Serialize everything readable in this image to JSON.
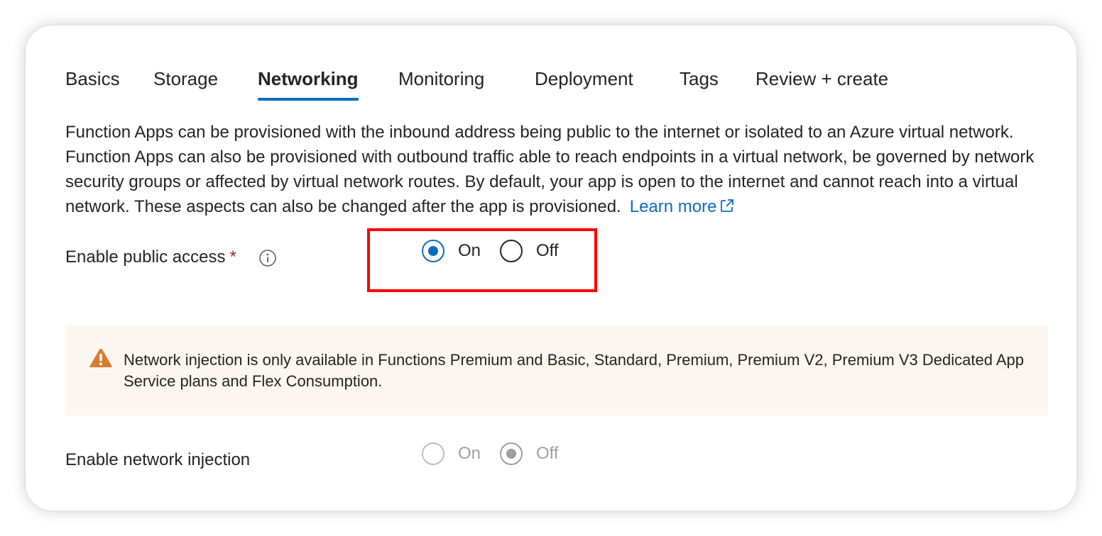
{
  "tabs": [
    {
      "label": "Basics",
      "active": false
    },
    {
      "label": "Storage",
      "active": false
    },
    {
      "label": "Networking",
      "active": true
    },
    {
      "label": "Monitoring",
      "active": false
    },
    {
      "label": "Deployment",
      "active": false
    },
    {
      "label": "Tags",
      "active": false
    },
    {
      "label": "Review + create",
      "active": false
    }
  ],
  "description": {
    "text": "Function Apps can be provisioned with the inbound address being public to the internet or isolated to an Azure virtual network. Function Apps can also be provisioned with outbound traffic able to reach endpoints in a virtual network, be governed by network security groups or affected by virtual network routes. By default, your app is open to the internet and cannot reach into a virtual network. These aspects can also be changed after the app is provisioned.",
    "link_label": "Learn more",
    "link_icon": "external-link-icon"
  },
  "public_access": {
    "label": "Enable public access",
    "required_mark": "*",
    "info_icon": "info-icon",
    "options": [
      "On",
      "Off"
    ],
    "selected": "On"
  },
  "warning": {
    "icon": "warning-icon",
    "text": "Network injection is only available in Functions Premium and Basic, Standard, Premium, Premium V2, Premium V3 Dedicated App Service plans and Flex Consumption."
  },
  "network_injection": {
    "label": "Enable network injection",
    "options": [
      "On",
      "Off"
    ],
    "selected": "Off",
    "disabled": true
  },
  "colors": {
    "accent": "#0f6cbd",
    "required": "#a4262c",
    "warning_bg": "#fdf6f0",
    "warning_icon": "#d97c2e",
    "highlight": "#ff0000"
  }
}
